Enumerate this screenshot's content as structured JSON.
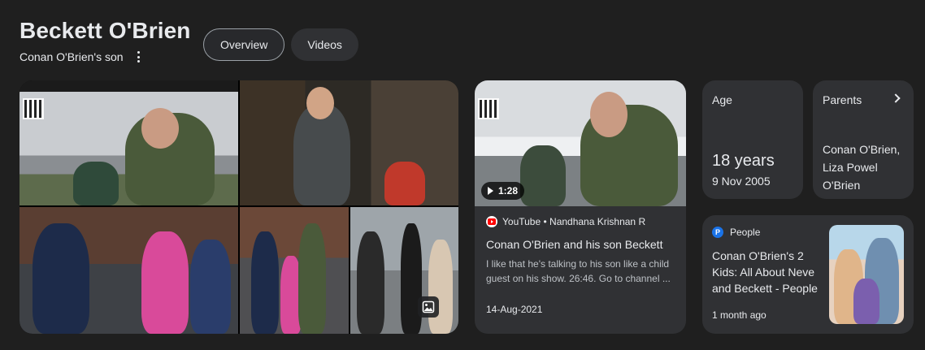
{
  "entity": {
    "title": "Beckett O'Brien",
    "subtitle": "Conan O'Brien's son"
  },
  "tabs": [
    {
      "label": "Overview",
      "active": true
    },
    {
      "label": "Videos",
      "active": false
    }
  ],
  "video": {
    "duration": "1:28",
    "source": "YouTube • Nandhana Krishnan R",
    "title": "Conan O'Brien and his son Beckett",
    "description": "I like that he's talking to his son like a child guest on his show. 26:46. Go to channel ...",
    "date": "14-Aug-2021"
  },
  "age": {
    "label": "Age",
    "value": "18 years",
    "birthdate": "9 Nov 2005"
  },
  "parents": {
    "label": "Parents",
    "line1": "Conan O'Brien,",
    "line2": "Liza Powel",
    "line3": "O'Brien"
  },
  "article": {
    "source": "People",
    "source_icon_letter": "P",
    "title": "Conan O'Brien's 2 Kids: All About Neve and Beckett - People",
    "date": "1 month ago"
  },
  "icons": {
    "more": "more-vert-icon",
    "image": "image-icon",
    "play": "play-icon",
    "youtube": "youtube-icon",
    "chevron": "chevron-right-icon"
  },
  "colors": {
    "background": "#1f1f1f",
    "card": "#303134",
    "text": "#e8eaed",
    "youtube_red": "#ff0000",
    "people_blue": "#1a73e8"
  }
}
